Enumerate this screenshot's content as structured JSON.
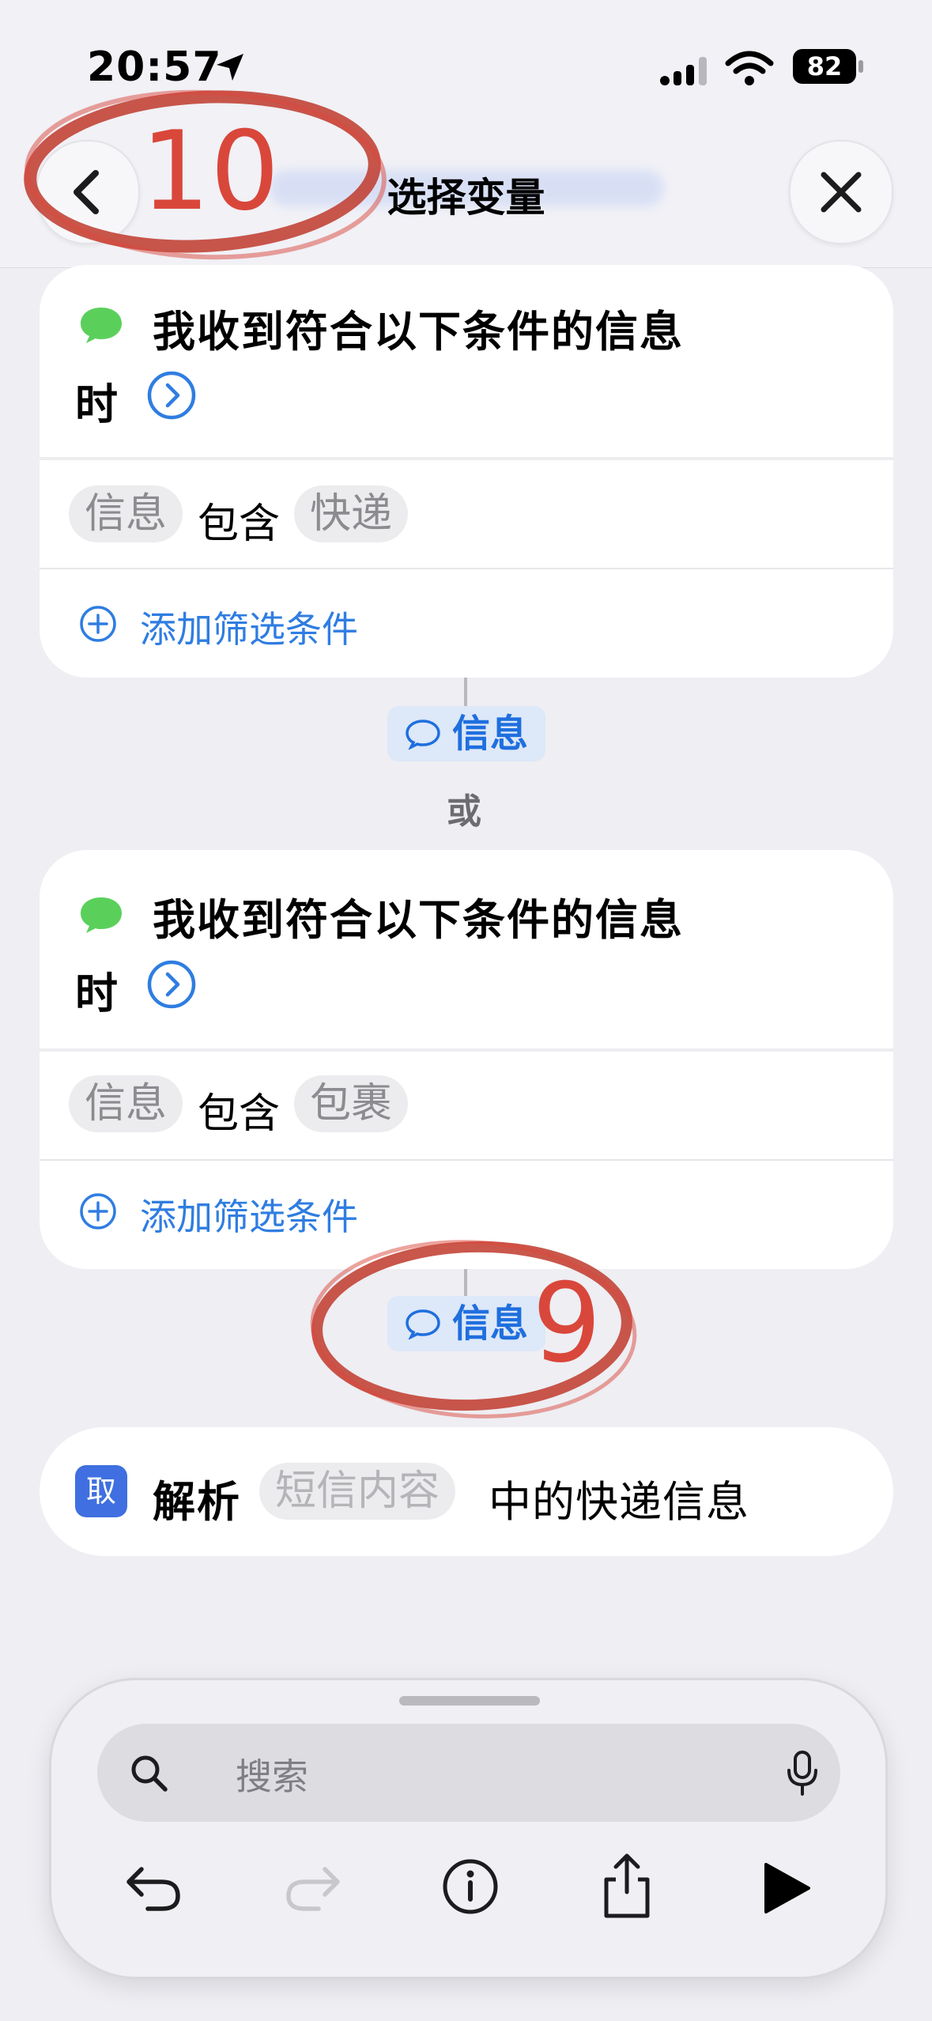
{
  "status_bar": {
    "time": "20:57",
    "battery": "82"
  },
  "nav": {
    "title": "选择变量",
    "back_icon": "chevron-left-icon",
    "close_icon": "xmark-icon"
  },
  "cards": [
    {
      "trigger_line1": "我收到符合以下条件的信息",
      "trigger_line2": "时",
      "condition": {
        "subject": "信息",
        "operator": "包含",
        "value": "快递"
      },
      "add_filter": "添加筛选条件"
    },
    {
      "trigger_line1": "我收到符合以下条件的信息",
      "trigger_line2": "时",
      "condition": {
        "subject": "信息",
        "operator": "包含",
        "value": "包裹"
      },
      "add_filter": "添加筛选条件"
    }
  ],
  "variables": [
    {
      "label": "信息"
    },
    {
      "label": "信息"
    }
  ],
  "or_label": "或",
  "action": {
    "verb": "解析",
    "param": "短信内容",
    "suffix": "中的快递信息",
    "app_glyph": "取"
  },
  "toolbar": {
    "search_placeholder": "搜索"
  },
  "annotations": {
    "step_a": "10",
    "step_b": "9"
  },
  "colors": {
    "accent": "#2f7de1",
    "messages_green": "#5ad05b",
    "annotation_red": "#d9473b"
  }
}
